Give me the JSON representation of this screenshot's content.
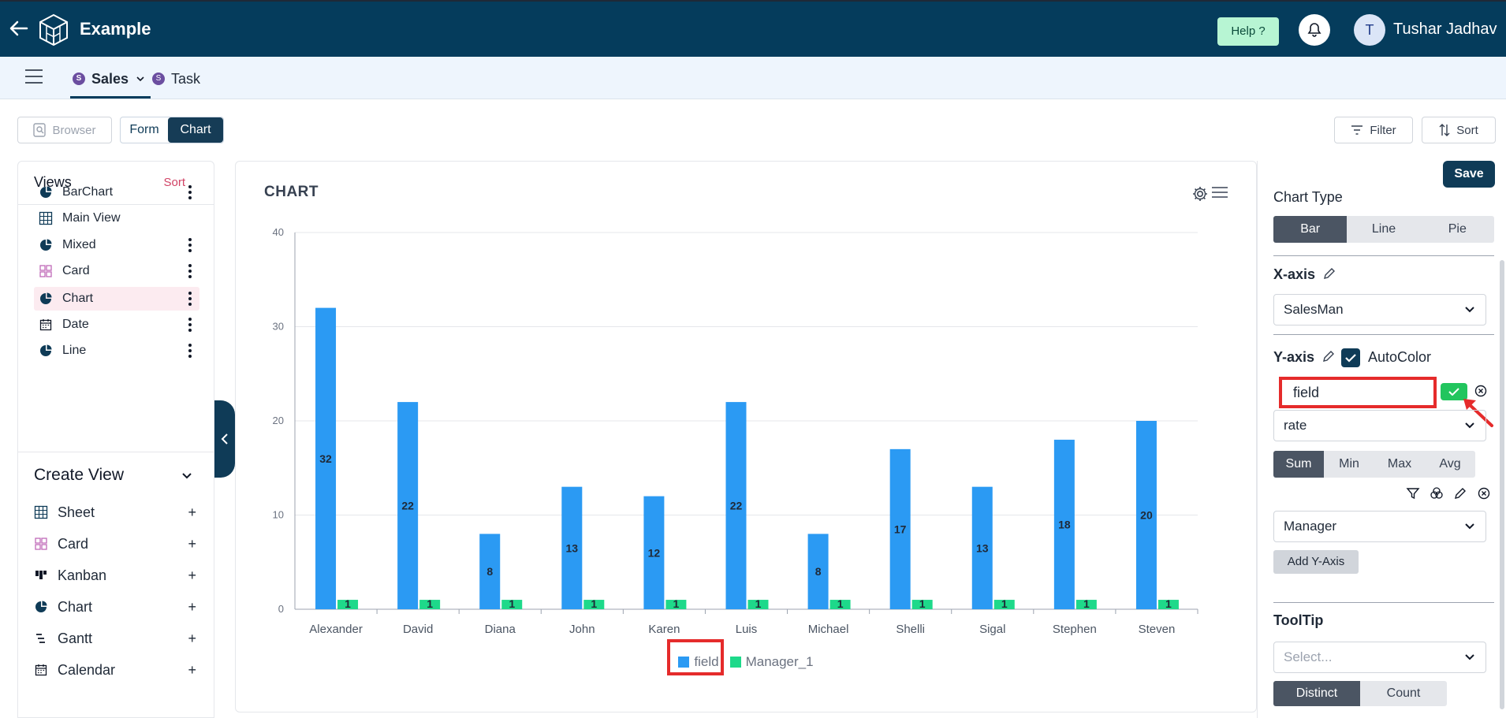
{
  "header": {
    "app_title": "Example",
    "help_label": "Help ?",
    "avatar_initial": "T",
    "user_name": "Tushar Jadhav"
  },
  "tabs": [
    {
      "badge": "S",
      "label": "Sales"
    },
    {
      "badge": "S",
      "label": "Task"
    }
  ],
  "toolbar": {
    "browser_label": "Browser",
    "form_label": "Form",
    "chart_label": "Chart",
    "filter_label": "Filter",
    "sort_label": "Sort"
  },
  "views": {
    "title": "Views",
    "sort_label": "Sort",
    "items": [
      {
        "label": "BarChart",
        "icon": "pie-icon"
      },
      {
        "label": "Main View",
        "icon": "grid-icon"
      },
      {
        "label": "Mixed",
        "icon": "pie-icon"
      },
      {
        "label": "Card",
        "icon": "card-icon"
      },
      {
        "label": "Chart",
        "icon": "pie-icon"
      },
      {
        "label": "Date",
        "icon": "calendar-icon"
      },
      {
        "label": "Line",
        "icon": "pie-icon"
      }
    ]
  },
  "create_view": {
    "title": "Create View",
    "items": [
      {
        "label": "Sheet",
        "icon": "grid-icon"
      },
      {
        "label": "Card",
        "icon": "card-icon"
      },
      {
        "label": "Kanban",
        "icon": "kanban-icon"
      },
      {
        "label": "Chart",
        "icon": "pie-icon"
      },
      {
        "label": "Gantt",
        "icon": "gantt-icon"
      },
      {
        "label": "Calendar",
        "icon": "calendar-icon"
      }
    ]
  },
  "chart_card": {
    "title": "CHART"
  },
  "chart_data": {
    "type": "bar",
    "categories": [
      "Alexander",
      "David",
      "Diana",
      "John",
      "Karen",
      "Luis",
      "Michael",
      "Shelli",
      "Sigal",
      "Stephen",
      "Steven"
    ],
    "series": [
      {
        "name": "field",
        "values": [
          32,
          22,
          8,
          13,
          12,
          22,
          8,
          17,
          13,
          18,
          20
        ],
        "color": "#2b9af3"
      },
      {
        "name": "Manager_1",
        "values": [
          1,
          1,
          1,
          1,
          1,
          1,
          1,
          1,
          1,
          1,
          1
        ],
        "color": "#1ed98a"
      }
    ],
    "yticks": [
      0,
      10,
      20,
      30,
      40
    ],
    "ylim": [
      0,
      40
    ],
    "grid": true,
    "legend": "bottom-center"
  },
  "settings": {
    "save_label": "Save",
    "chart_type_label": "Chart Type",
    "chart_types": [
      "Bar",
      "Line",
      "Pie"
    ],
    "selected_chart_type": "Bar",
    "x_axis_label": "X-axis",
    "x_axis_value": "SalesMan",
    "y_axis_label": "Y-axis",
    "autocolor_label": "AutoColor",
    "field_input_value": "field",
    "y_field_value": "rate",
    "aggregations": [
      "Sum",
      "Min",
      "Max",
      "Avg"
    ],
    "selected_aggregation": "Sum",
    "group_value": "Manager",
    "add_y_label": "Add Y-Axis",
    "tooltip_label": "ToolTip",
    "tooltip_placeholder": "Select...",
    "tooltip_modes": [
      "Distinct",
      "Count"
    ],
    "selected_tooltip_mode": "Distinct"
  },
  "colors": {
    "navbar": "#053c5c",
    "accent_pink": "#d14365",
    "highlight_red": "#e52b2b",
    "ok_green": "#22c55e"
  }
}
